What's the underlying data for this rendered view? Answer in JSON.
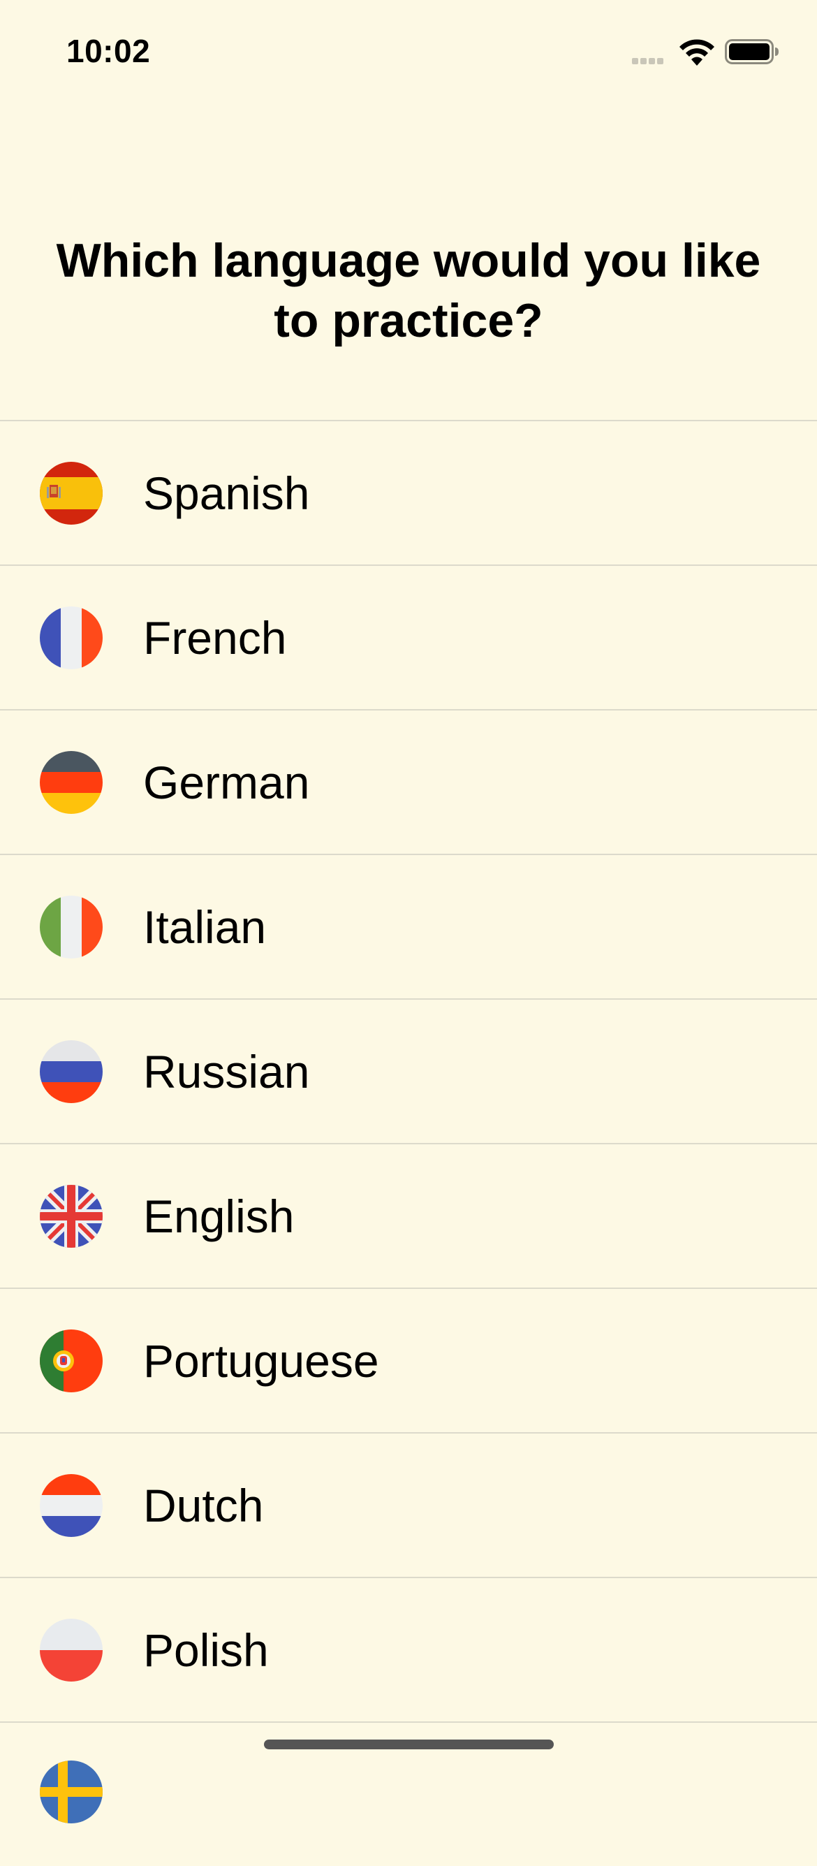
{
  "status_bar": {
    "time": "10:02"
  },
  "title": "Which language would you like to practice?",
  "languages": [
    {
      "label": "Spanish",
      "flag": "spain-flag-icon"
    },
    {
      "label": "French",
      "flag": "france-flag-icon"
    },
    {
      "label": "German",
      "flag": "germany-flag-icon"
    },
    {
      "label": "Italian",
      "flag": "italy-flag-icon"
    },
    {
      "label": "Russian",
      "flag": "russia-flag-icon"
    },
    {
      "label": "English",
      "flag": "uk-flag-icon"
    },
    {
      "label": "Portuguese",
      "flag": "portugal-flag-icon"
    },
    {
      "label": "Dutch",
      "flag": "netherlands-flag-icon"
    },
    {
      "label": "Polish",
      "flag": "poland-flag-icon"
    }
  ],
  "colors": {
    "background": "#fdf9e4",
    "divider": "#dcdacb",
    "text": "#000000"
  }
}
